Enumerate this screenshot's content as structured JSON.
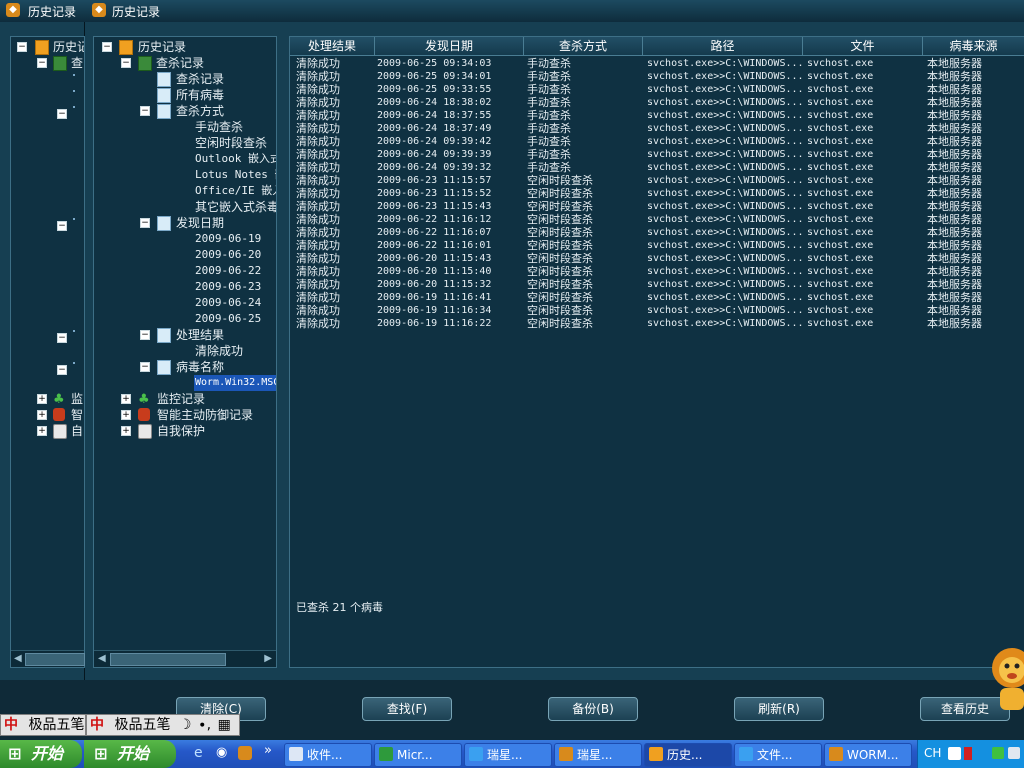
{
  "window": {
    "title": "历史记录",
    "back_title": "历史记录"
  },
  "back_tree": {
    "items": [
      "历史记",
      "查",
      "监",
      "智",
      "自"
    ]
  },
  "tree": {
    "root": "历史记录",
    "scan": "查杀记录",
    "scan_children": [
      "查杀记录",
      "所有病毒"
    ],
    "method": "查杀方式",
    "method_children": [
      "手动查杀",
      "空闲时段查杀",
      "Outlook 嵌入式",
      "Lotus Notes 嵌",
      "Office/IE 嵌入",
      "其它嵌入式杀毒"
    ],
    "date": "发现日期",
    "date_children": [
      "2009-06-19",
      "2009-06-20",
      "2009-06-22",
      "2009-06-23",
      "2009-06-24",
      "2009-06-25"
    ],
    "result": "处理结果",
    "result_children": [
      "清除成功"
    ],
    "virus": "病毒名称",
    "virus_children": [
      "Worm.Win32.MSC"
    ],
    "monitor": "监控记录",
    "defense": "智能主动防御记录",
    "self": "自我保护"
  },
  "table": {
    "columns": [
      "处理结果",
      "发现日期",
      "查杀方式",
      "路径",
      "文件",
      "病毒来源"
    ],
    "rows": [
      [
        "清除成功",
        "2009-06-25 09:34:03",
        "手动查杀",
        "svchost.exe>>C:\\WINDOWS...",
        "svchost.exe",
        "本地服务器"
      ],
      [
        "清除成功",
        "2009-06-25 09:34:01",
        "手动查杀",
        "svchost.exe>>C:\\WINDOWS...",
        "svchost.exe",
        "本地服务器"
      ],
      [
        "清除成功",
        "2009-06-25 09:33:55",
        "手动查杀",
        "svchost.exe>>C:\\WINDOWS...",
        "svchost.exe",
        "本地服务器"
      ],
      [
        "清除成功",
        "2009-06-24 18:38:02",
        "手动查杀",
        "svchost.exe>>C:\\WINDOWS...",
        "svchost.exe",
        "本地服务器"
      ],
      [
        "清除成功",
        "2009-06-24 18:37:55",
        "手动查杀",
        "svchost.exe>>C:\\WINDOWS...",
        "svchost.exe",
        "本地服务器"
      ],
      [
        "清除成功",
        "2009-06-24 18:37:49",
        "手动查杀",
        "svchost.exe>>C:\\WINDOWS...",
        "svchost.exe",
        "本地服务器"
      ],
      [
        "清除成功",
        "2009-06-24 09:39:42",
        "手动查杀",
        "svchost.exe>>C:\\WINDOWS...",
        "svchost.exe",
        "本地服务器"
      ],
      [
        "清除成功",
        "2009-06-24 09:39:39",
        "手动查杀",
        "svchost.exe>>C:\\WINDOWS...",
        "svchost.exe",
        "本地服务器"
      ],
      [
        "清除成功",
        "2009-06-24 09:39:32",
        "手动查杀",
        "svchost.exe>>C:\\WINDOWS...",
        "svchost.exe",
        "本地服务器"
      ],
      [
        "清除成功",
        "2009-06-23 11:15:57",
        "空闲时段查杀",
        "svchost.exe>>C:\\WINDOWS...",
        "svchost.exe",
        "本地服务器"
      ],
      [
        "清除成功",
        "2009-06-23 11:15:52",
        "空闲时段查杀",
        "svchost.exe>>C:\\WINDOWS...",
        "svchost.exe",
        "本地服务器"
      ],
      [
        "清除成功",
        "2009-06-23 11:15:43",
        "空闲时段查杀",
        "svchost.exe>>C:\\WINDOWS...",
        "svchost.exe",
        "本地服务器"
      ],
      [
        "清除成功",
        "2009-06-22 11:16:12",
        "空闲时段查杀",
        "svchost.exe>>C:\\WINDOWS...",
        "svchost.exe",
        "本地服务器"
      ],
      [
        "清除成功",
        "2009-06-22 11:16:07",
        "空闲时段查杀",
        "svchost.exe>>C:\\WINDOWS...",
        "svchost.exe",
        "本地服务器"
      ],
      [
        "清除成功",
        "2009-06-22 11:16:01",
        "空闲时段查杀",
        "svchost.exe>>C:\\WINDOWS...",
        "svchost.exe",
        "本地服务器"
      ],
      [
        "清除成功",
        "2009-06-20 11:15:43",
        "空闲时段查杀",
        "svchost.exe>>C:\\WINDOWS...",
        "svchost.exe",
        "本地服务器"
      ],
      [
        "清除成功",
        "2009-06-20 11:15:40",
        "空闲时段查杀",
        "svchost.exe>>C:\\WINDOWS...",
        "svchost.exe",
        "本地服务器"
      ],
      [
        "清除成功",
        "2009-06-20 11:15:32",
        "空闲时段查杀",
        "svchost.exe>>C:\\WINDOWS...",
        "svchost.exe",
        "本地服务器"
      ],
      [
        "清除成功",
        "2009-06-19 11:16:41",
        "空闲时段查杀",
        "svchost.exe>>C:\\WINDOWS...",
        "svchost.exe",
        "本地服务器"
      ],
      [
        "清除成功",
        "2009-06-19 11:16:34",
        "空闲时段查杀",
        "svchost.exe>>C:\\WINDOWS...",
        "svchost.exe",
        "本地服务器"
      ],
      [
        "清除成功",
        "2009-06-19 11:16:22",
        "空闲时段查杀",
        "svchost.exe>>C:\\WINDOWS...",
        "svchost.exe",
        "本地服务器"
      ]
    ]
  },
  "status": "已查杀 21 个病毒",
  "buttons": {
    "clear": "清除(C)",
    "find": "查找(F)",
    "backup": "备份(B)",
    "refresh": "刷新(R)",
    "view_history": "查看历史"
  },
  "ime": {
    "label": "极品五笔",
    "zhong": "中"
  },
  "taskbar": {
    "start": "开始",
    "overflow": "»",
    "tasks": [
      "收件...",
      "Micr...",
      "瑞星...",
      "瑞星...",
      "历史...",
      "文件...",
      "WORM..."
    ],
    "lang": "CH"
  },
  "colors": {
    "background": "#0f2a38",
    "panel": "#0f3142",
    "selection": "#1b57b8",
    "taskbar": "#2658c8",
    "start": "#3a9a36"
  }
}
